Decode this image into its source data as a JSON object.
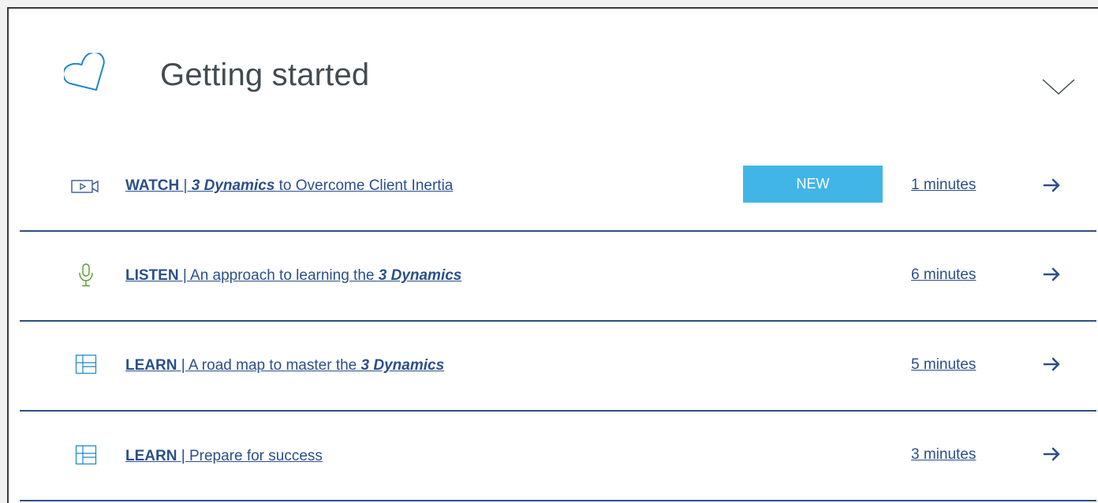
{
  "section": {
    "title": "Getting started",
    "icon": "heart-outline-icon",
    "collapse_icon": "chevron-down-icon",
    "colors": {
      "icon": "#1a86c8",
      "title": "#414b52",
      "divider": "#2f4f86",
      "link": "#2a4f8a",
      "badge": "#41b6e6"
    }
  },
  "items": [
    {
      "kind": "WATCH",
      "sep": " | ",
      "em": "3 Dynamics",
      "rest_before": "",
      "rest_after": " to Overcome Client Inertia",
      "badge": "NEW",
      "duration": "1 minutes",
      "icon": "video-camera-icon"
    },
    {
      "kind": "LISTEN",
      "sep": " | ",
      "em": "3 Dynamics",
      "rest_before": "An approach to learning the ",
      "rest_after": "",
      "badge": "",
      "duration": "6 minutes",
      "icon": "microphone-icon"
    },
    {
      "kind": "LEARN",
      "sep": " | ",
      "em": "3 Dynamics",
      "rest_before": "A road map to master the ",
      "rest_after": "",
      "badge": "",
      "duration": "5 minutes",
      "icon": "layout-grid-icon"
    },
    {
      "kind": "LEARN",
      "sep": " | ",
      "em": "",
      "rest_before": "Prepare for success",
      "rest_after": "",
      "badge": "",
      "duration": "3 minutes",
      "icon": "layout-grid-icon"
    }
  ]
}
